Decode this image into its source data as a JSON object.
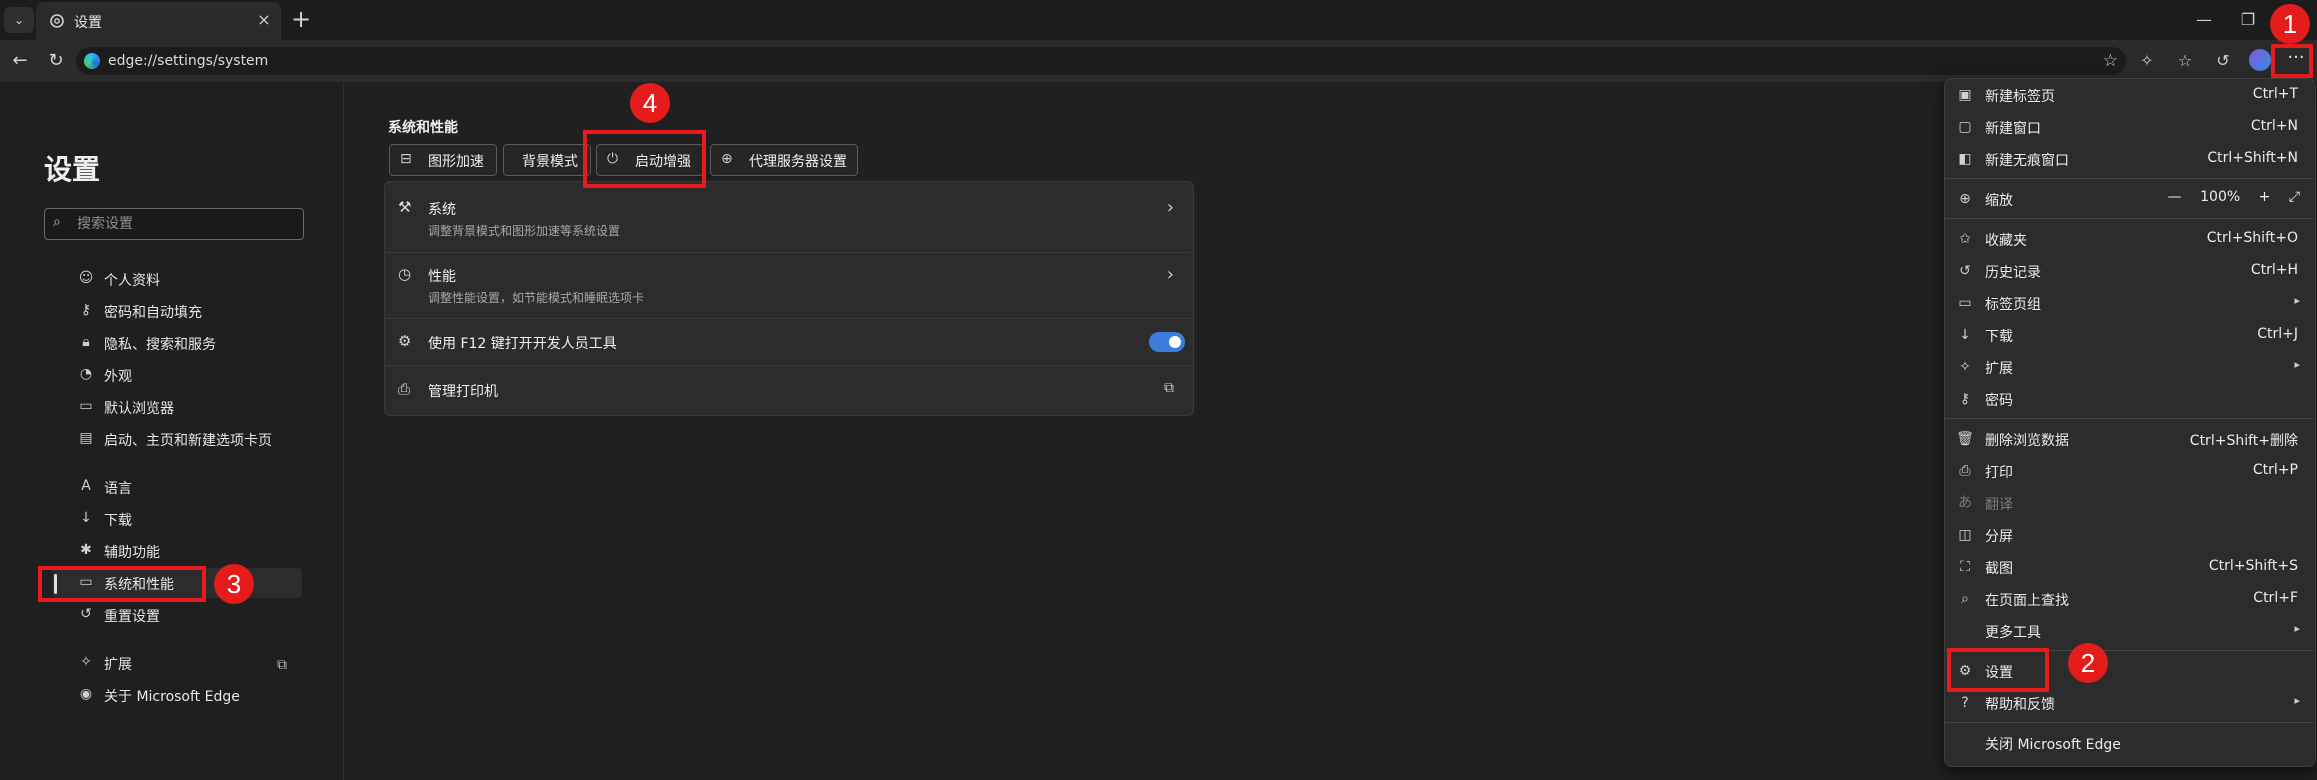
{
  "browser": {
    "tab_title": "设置",
    "tab_close": "×",
    "new_tab": "+",
    "url": "edge://settings/system",
    "window_controls": [
      "—",
      "❐"
    ]
  },
  "sidebar": {
    "title": "设置",
    "search_placeholder": "搜索设置",
    "items": [
      {
        "label": "个人资料",
        "icon": "person-icon"
      },
      {
        "label": "密码和自动填充",
        "icon": "key-icon"
      },
      {
        "label": "隐私、搜索和服务",
        "icon": "lock-icon"
      },
      {
        "label": "外观",
        "icon": "palette-icon"
      },
      {
        "label": "默认浏览器",
        "icon": "browser-icon"
      },
      {
        "label": "启动、主页和新建选项卡页",
        "icon": "home-icon"
      },
      {
        "label": "语言",
        "icon": "language-icon"
      },
      {
        "label": "下载",
        "icon": "download-icon"
      },
      {
        "label": "辅助功能",
        "icon": "accessibility-icon"
      },
      {
        "label": "系统和性能",
        "icon": "laptop-icon"
      },
      {
        "label": "重置设置",
        "icon": "reset-icon"
      },
      {
        "label": "扩展",
        "icon": "puzzle-icon"
      },
      {
        "label": "关于 Microsoft Edge",
        "icon": "edge-icon"
      }
    ],
    "active_item": "系统和性能"
  },
  "main": {
    "section_title": "系统和性能",
    "chips": [
      {
        "label": "图形加速",
        "icon": "drive-icon"
      },
      {
        "label": "背景模式",
        "icon": ""
      },
      {
        "label": "启动增强",
        "icon": "power-icon"
      },
      {
        "label": "代理服务器设置",
        "icon": "globe-icon"
      }
    ],
    "rows": [
      {
        "title": "系统",
        "subtitle": "调整背景模式和图形加速等系统设置",
        "icon": "wrench-icon"
      },
      {
        "title": "性能",
        "subtitle": "调整性能设置，如节能模式和睡眠选项卡",
        "icon": "speedometer-icon"
      },
      {
        "title": "使用 F12 键打开开发人员工具",
        "toggle_on": true,
        "icon": "devtools-icon"
      },
      {
        "title": "管理打印机",
        "icon": "printer-icon"
      }
    ]
  },
  "menu": {
    "items": [
      {
        "label": "新建标签页",
        "shortcut": "Ctrl+T",
        "icon": "new-tab-icon"
      },
      {
        "label": "新建窗口",
        "shortcut": "Ctrl+N",
        "icon": "new-window-icon"
      },
      {
        "label": "新建无痕窗口",
        "shortcut": "Ctrl+Shift+N",
        "icon": "inprivate-icon"
      },
      {
        "label": "缩放",
        "icon": "zoom-icon",
        "zoom": {
          "minus": "—",
          "value": "100%",
          "plus": "+",
          "fullscreen": "⤢"
        }
      },
      {
        "label": "收藏夹",
        "shortcut": "Ctrl+Shift+O",
        "icon": "favorites-icon"
      },
      {
        "label": "历史记录",
        "shortcut": "Ctrl+H",
        "icon": "history-icon"
      },
      {
        "label": "标签页组",
        "submenu": true,
        "icon": "tab-groups-icon"
      },
      {
        "label": "下载",
        "shortcut": "Ctrl+J",
        "icon": "download-icon"
      },
      {
        "label": "扩展",
        "submenu": true,
        "icon": "extensions-icon"
      },
      {
        "label": "密码",
        "icon": "key-icon"
      },
      {
        "label": "删除浏览数据",
        "shortcut": "Ctrl+Shift+删除",
        "icon": "trash-icon"
      },
      {
        "label": "打印",
        "shortcut": "Ctrl+P",
        "icon": "printer-icon"
      },
      {
        "label": "翻译",
        "disabled": true,
        "icon": "translate-icon"
      },
      {
        "label": "分屏",
        "icon": "split-screen-icon"
      },
      {
        "label": "截图",
        "shortcut": "Ctrl+Shift+S",
        "icon": "screenshot-icon"
      },
      {
        "label": "在页面上查找",
        "shortcut": "Ctrl+F",
        "icon": "find-icon"
      },
      {
        "label": "更多工具",
        "submenu": true,
        "icon": ""
      },
      {
        "label": "设置",
        "icon": "settings-icon"
      },
      {
        "label": "帮助和反馈",
        "submenu": true,
        "icon": "help-icon"
      },
      {
        "label": "关闭 Microsoft Edge",
        "icon": ""
      }
    ]
  },
  "annotations": {
    "step1": "1",
    "step2": "2",
    "step3": "3",
    "step4": "4",
    "color": "#e41c1c"
  }
}
